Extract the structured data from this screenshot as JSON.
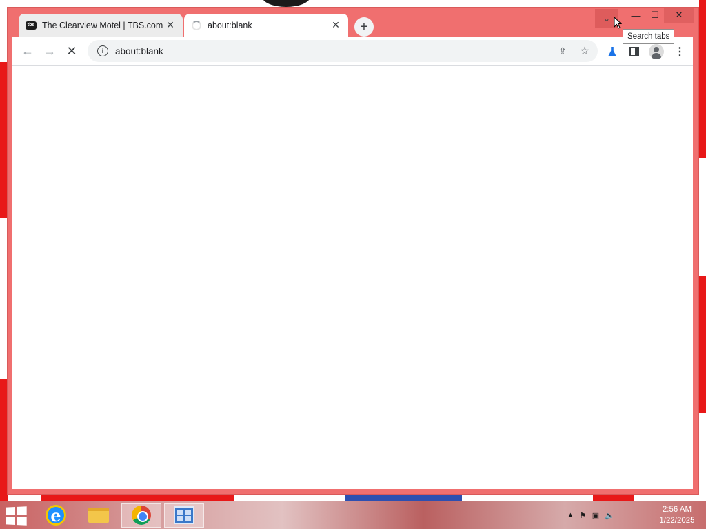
{
  "tabs": [
    {
      "title": "The Clearview Motel | TBS.com",
      "favicon": "tbs-icon",
      "favicon_text": "tbs",
      "active": false
    },
    {
      "title": "about:blank",
      "favicon": "loading-spinner-icon",
      "active": true
    }
  ],
  "toolbar": {
    "url": "about:blank"
  },
  "tooltip": {
    "text": "Search tabs"
  },
  "taskbar": {
    "items": [
      "start-icon",
      "internet-explorer-icon",
      "file-explorer-icon",
      "chrome-icon",
      "server-manager-icon"
    ],
    "clock": {
      "time": "2:56 AM",
      "date": "1/22/2025"
    }
  },
  "colors": {
    "window_frame": "#f06f6f",
    "tab_inactive": "#ececec",
    "tab_active": "#ffffff",
    "wallpaper_red": "#e81818"
  }
}
